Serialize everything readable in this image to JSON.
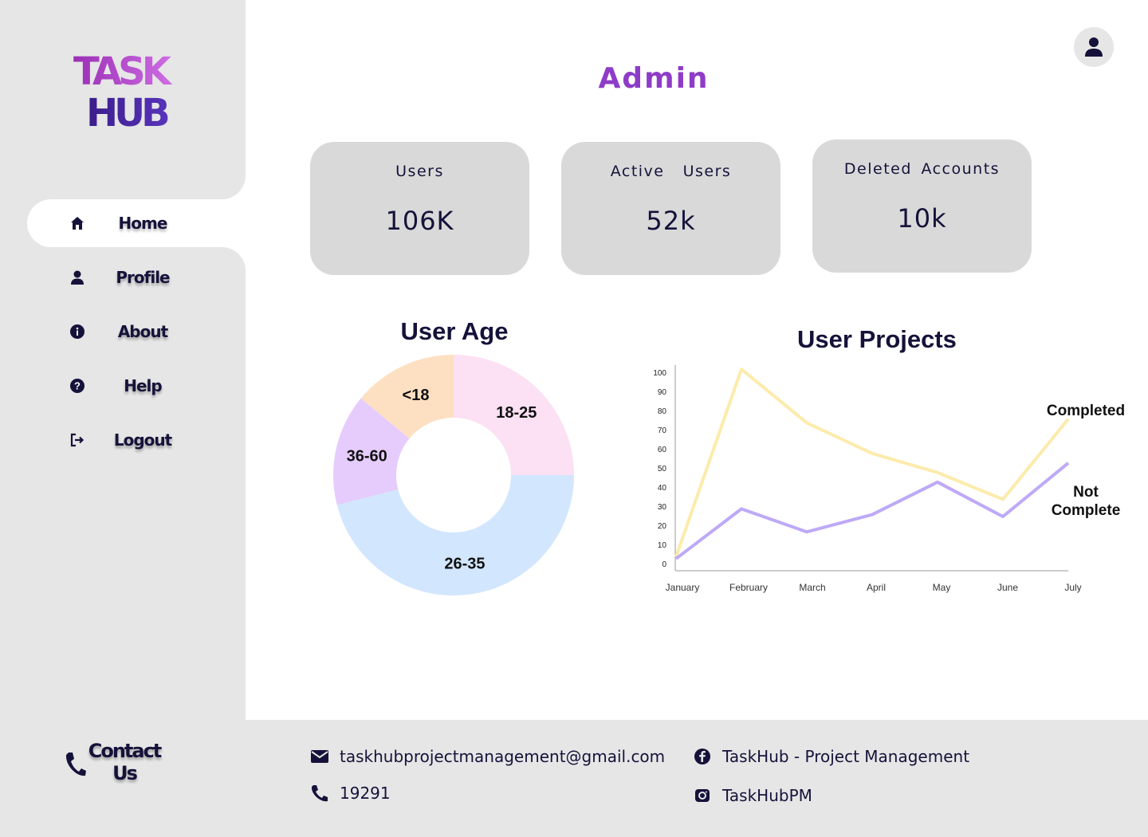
{
  "app": {
    "logo_line1": "TASK",
    "logo_line2": "HUB"
  },
  "header": {
    "title": "Admin",
    "avatar_icon": "user-icon"
  },
  "sidebar": {
    "items": [
      {
        "label": "Home",
        "icon": "home-icon",
        "active": true
      },
      {
        "label": "Profile",
        "icon": "user-icon",
        "active": false
      },
      {
        "label": "About",
        "icon": "info-icon",
        "active": false
      },
      {
        "label": "Help",
        "icon": "help-icon",
        "active": false
      },
      {
        "label": "Logout",
        "icon": "logout-icon",
        "active": false
      }
    ]
  },
  "stats": [
    {
      "label": "Users",
      "value": "106K"
    },
    {
      "label": "Active  Users",
      "value": "52k"
    },
    {
      "label": "Deleted Accounts",
      "value": "10k"
    }
  ],
  "colors": {
    "primary_dark": "#15123a",
    "accent_purple": "#8e3cc8",
    "sidebar_bg": "#e6e6e6",
    "card_bg": "#d9d9d9"
  },
  "chart_data": [
    {
      "type": "pie",
      "title": "User Age",
      "donut": true,
      "categories": [
        "18-25",
        "26-35",
        "36-60",
        "<18"
      ],
      "values": [
        25,
        46,
        15,
        14
      ],
      "colors": [
        "#fce0f3",
        "#d2e6fe",
        "#e6ccfd",
        "#fde0c2"
      ]
    },
    {
      "type": "line",
      "title": "User Projects",
      "categories": [
        "January",
        "February",
        "March",
        "April",
        "May",
        "June",
        "July"
      ],
      "y_ticks": [
        "0",
        "10",
        "20",
        "30",
        "40",
        "50",
        "60",
        "70",
        "80",
        "90",
        "100"
      ],
      "ylim": [
        0,
        100
      ],
      "series": [
        {
          "name": "Completed",
          "values": [
            4,
            102,
            74,
            58,
            48,
            34,
            76
          ],
          "color": "#fcebab"
        },
        {
          "name": "Not Complete",
          "values": [
            3,
            29,
            17,
            26,
            43,
            25,
            53
          ],
          "color": "#bda9f7"
        }
      ]
    }
  ],
  "footer": {
    "contact_label": "Contact Us",
    "email": "taskhubprojectmanagement@gmail.com",
    "phone": "19291",
    "facebook": "TaskHub - Project Management",
    "instagram": "TaskHubPM"
  }
}
